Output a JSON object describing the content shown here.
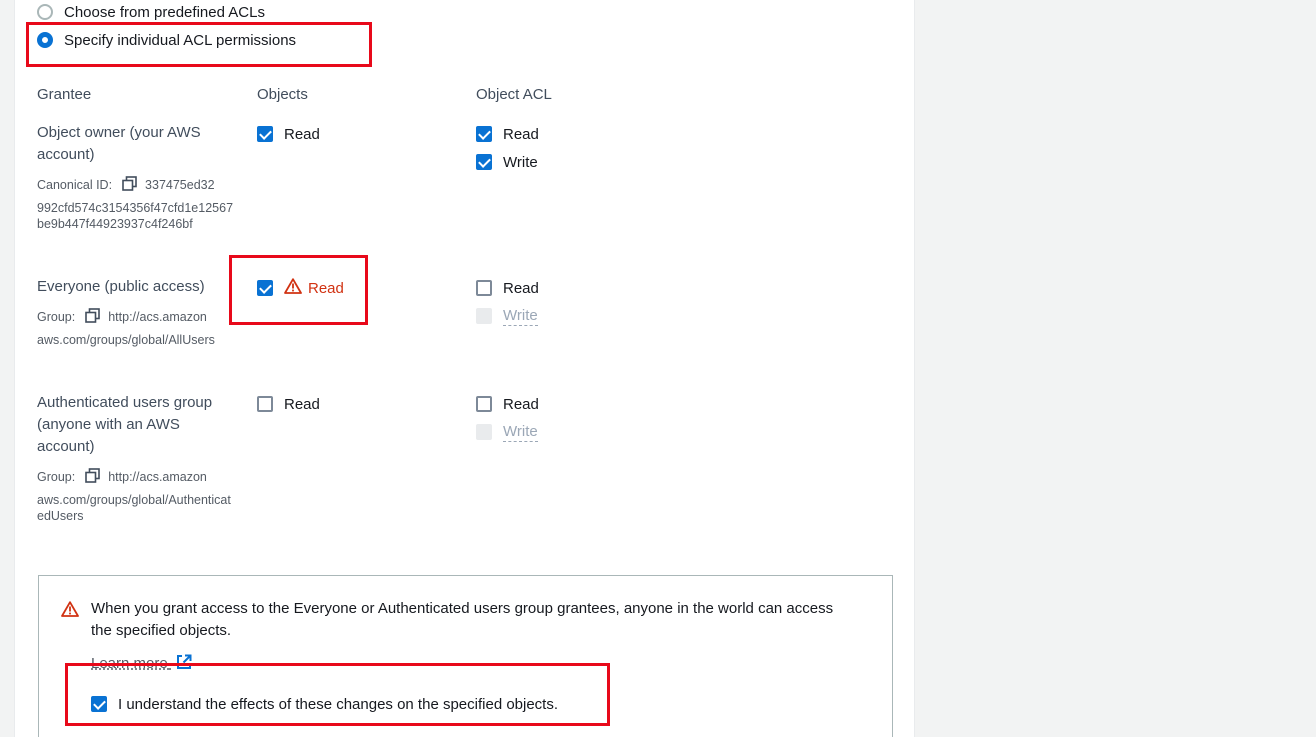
{
  "acl_options": {
    "predefined_label": "Choose from predefined ACLs",
    "individual_label": "Specify individual ACL permissions",
    "selected": "individual"
  },
  "columns": {
    "grantee": "Grantee",
    "objects": "Objects",
    "object_acl": "Object ACL"
  },
  "grantees": {
    "owner": {
      "name": "Object owner (your AWS account)",
      "id_label": "Canonical ID:",
      "id_value_line1": "337475ed32",
      "id_value_rest": "992cfd574c3154356f47cfd1e12567be9b447f44923937c4f246bf",
      "objects_read": "Read",
      "acl_read": "Read",
      "acl_write": "Write"
    },
    "everyone": {
      "name": "Everyone (public access)",
      "group_label": "Group:",
      "group_value_line1": "http://acs.amazon",
      "group_value_rest": "aws.com/groups/global/AllUsers",
      "objects_read": "Read",
      "acl_read": "Read",
      "acl_write": "Write"
    },
    "authenticated": {
      "name": "Authenticated users group (anyone with an AWS account)",
      "group_label": "Group:",
      "group_value_line1": "http://acs.amazon",
      "group_value_rest": "aws.com/groups/global/AuthenticatedUsers",
      "objects_read": "Read",
      "acl_read": "Read",
      "acl_write": "Write"
    }
  },
  "alert": {
    "message": "When you grant access to the Everyone or Authenticated users group grantees, anyone in the world can access the specified objects.",
    "learn_more": "Learn more",
    "acknowledge": "I understand the effects of these changes on the specified objects."
  },
  "colors": {
    "accent": "#0972d3",
    "warning": "#d13212",
    "highlight": "#e8091a"
  }
}
